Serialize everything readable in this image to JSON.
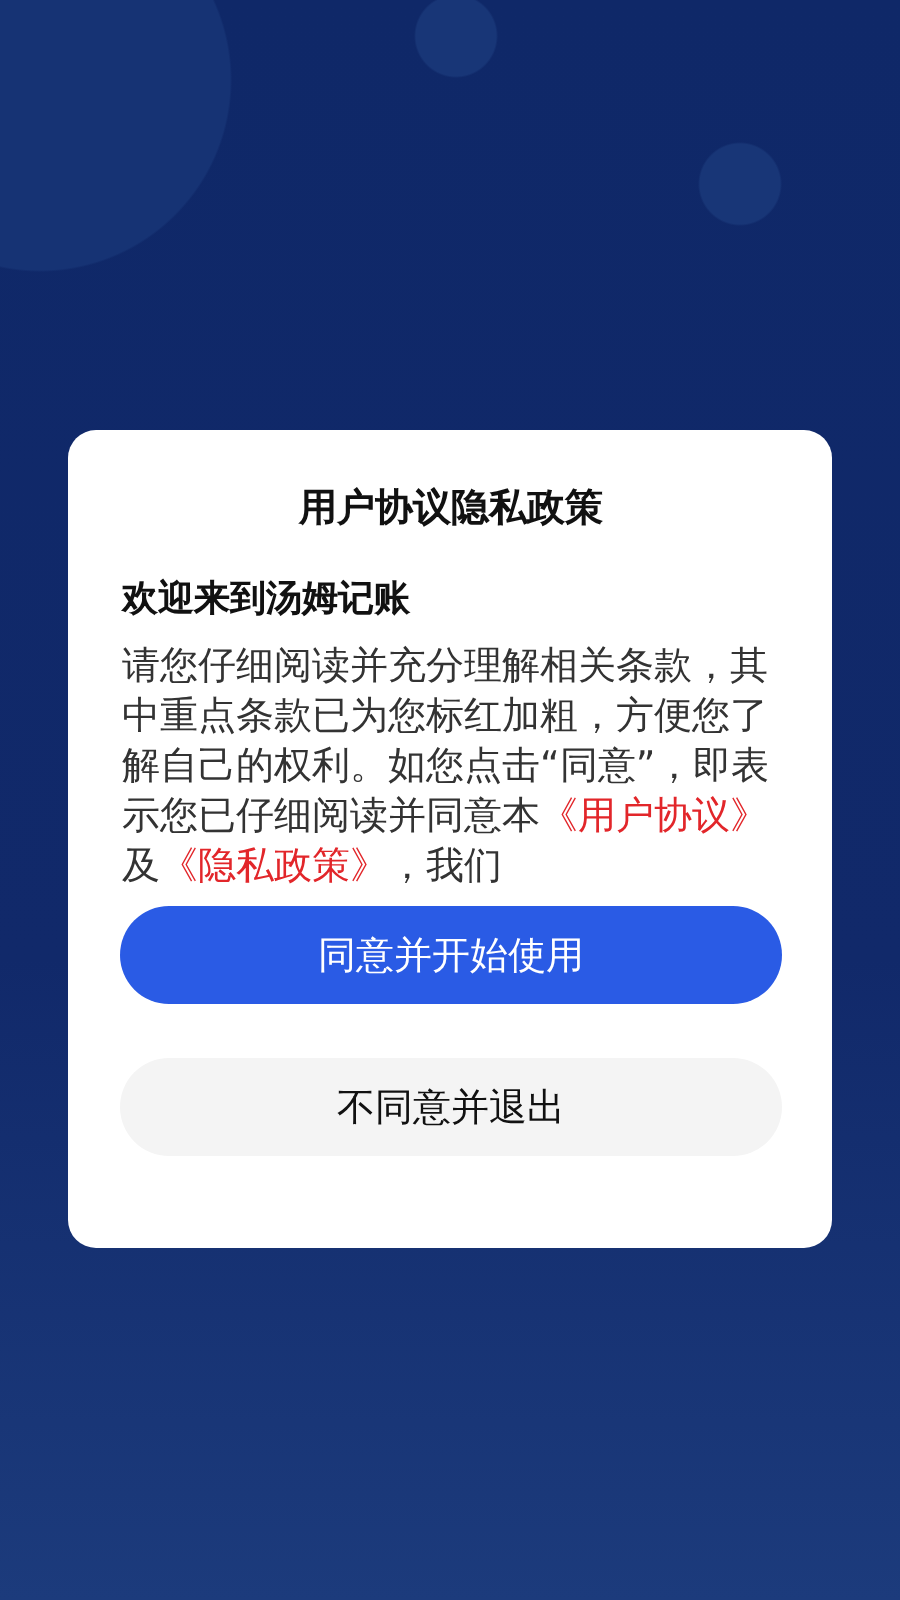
{
  "dialog": {
    "title": "用户协议隐私政策",
    "heading": "欢迎来到汤姆记账",
    "body": [
      {
        "kind": "text",
        "text": "请您仔细阅读并充分理解相关条款，其中重点条款已为您标红加粗，方便您了解自己的权利。如您点击“同意”，即表示您已仔细阅读并同意本"
      },
      {
        "kind": "link",
        "text": "《用户协议》"
      },
      {
        "kind": "text",
        "text": "及"
      },
      {
        "kind": "link",
        "text": "《隐私政策》"
      },
      {
        "kind": "text",
        "text": "，我们"
      }
    ],
    "buttons": [
      {
        "label": "同意并开始使用",
        "kind": "primary"
      },
      {
        "label": "不同意并退出",
        "kind": "secondary"
      }
    ]
  }
}
